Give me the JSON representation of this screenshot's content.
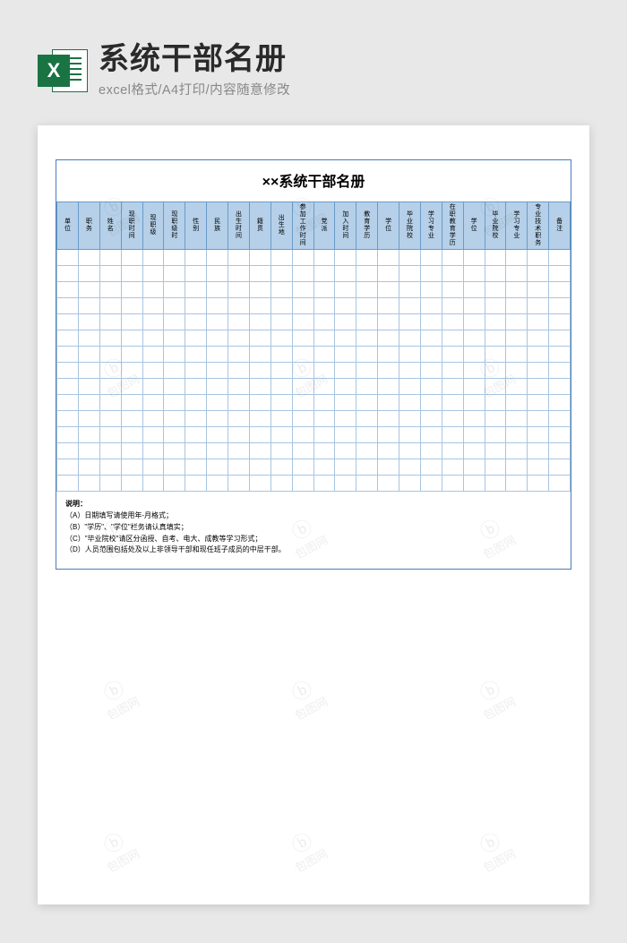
{
  "header": {
    "icon_letter": "X",
    "title": "系统干部名册",
    "subtitle": "excel格式/A4打印/内容随意修改"
  },
  "document": {
    "title": "××系统干部名册",
    "columns": [
      "单位",
      "职务",
      "姓名",
      "现职时间",
      "现职级",
      "现职级时",
      "性别",
      "民族",
      "出生时间",
      "籍贯",
      "出生地",
      "参加工作时间",
      "党派",
      "加入时间",
      "教育学历",
      "学位",
      "毕业院校",
      "学习专业",
      "在职教育学历",
      "学位",
      "毕业院校",
      "学习专业",
      "专业技术职务",
      "备注"
    ],
    "blank_rows": 15,
    "notes_title": "说明：",
    "notes": [
      "（A）日期填写请使用年-月格式；",
      "（B）\"学历\"、\"学位\"栏务请认真填实；",
      "（C）\"毕业院校\"请区分函授、自考、电大、成教等学习形式；",
      "（D）人员范围包括处及以上非领导干部和现任班子成员的中层干部。"
    ]
  },
  "watermark": {
    "logo": "ⓑ",
    "text": "包图网"
  }
}
